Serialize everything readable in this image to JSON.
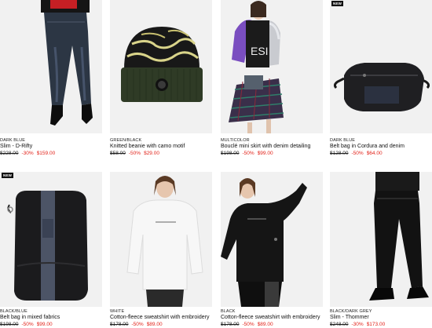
{
  "colors": {
    "sale": "#e2231a",
    "image_bg": "#f1f1f1",
    "text": "#111111"
  },
  "products": [
    {
      "badge": "",
      "color": "DARK BLUE",
      "name": "Slim - D-Rifty",
      "old_price": "$228.00",
      "discount": "-30%",
      "price": "$159.00",
      "image": "jeans-model-image"
    },
    {
      "badge": "",
      "color": "GREEN/BLACK",
      "name": "Knitted beanie with camo motif",
      "old_price": "$58.00",
      "discount": "-50%",
      "price": "$29.00",
      "image": "beanie-image"
    },
    {
      "badge": "",
      "color": "MULTICOLOR",
      "name": "Bouclé mini skirt with denim detailing",
      "old_price": "$198.00",
      "discount": "-50%",
      "price": "$99.00",
      "image": "skirt-model-image"
    },
    {
      "badge": "NEW",
      "color": "DARK BLUE",
      "name": "Belt bag in Cordura and denim",
      "old_price": "$128.00",
      "discount": "-50%",
      "price": "$64.00",
      "image": "belt-bag-image"
    },
    {
      "badge": "NEW",
      "color": "BLACK/BLUE",
      "name": "Belt bag in mixed fabrics",
      "old_price": "$198.00",
      "discount": "-50%",
      "price": "$99.00",
      "image": "mixed-bag-image"
    },
    {
      "badge": "",
      "color": "WHITE",
      "name": "Cotton-fleece sweatshirt with embroidery",
      "old_price": "$178.00",
      "discount": "-50%",
      "price": "$89.00",
      "image": "white-sweatshirt-image"
    },
    {
      "badge": "",
      "color": "BLACK",
      "name": "Cotton-fleece sweatshirt with embroidery",
      "old_price": "$178.00",
      "discount": "-50%",
      "price": "$89.00",
      "image": "black-sweatshirt-image"
    },
    {
      "badge": "",
      "color": "BLACK/DARK GREY",
      "name": "Slim - Thommer",
      "old_price": "$248.00",
      "discount": "-30%",
      "price": "$173.00",
      "image": "black-jeans-image"
    }
  ]
}
